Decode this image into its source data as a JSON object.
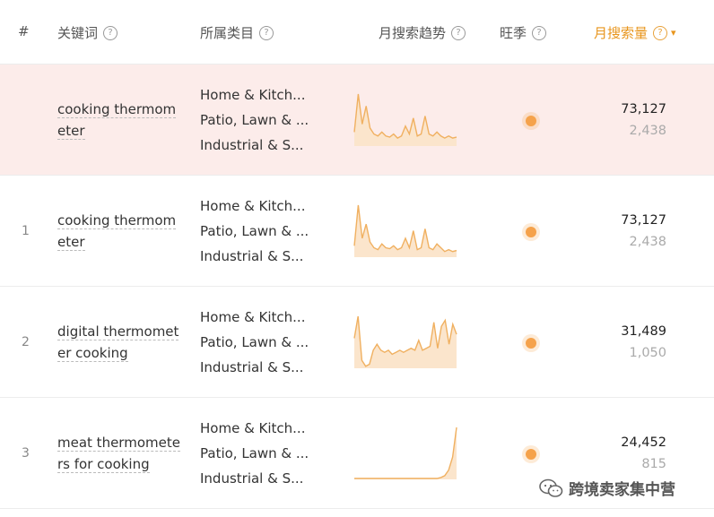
{
  "header": {
    "rank": "#",
    "keyword": "关键词",
    "category": "所属类目",
    "trend": "月搜索趋势",
    "season": "旺季",
    "volume": "月搜索量",
    "help_icon": "question-circle-icon",
    "sort_icon": "chevron-down-icon"
  },
  "colors": {
    "accent": "#e8951c",
    "highlight_row": "#fcecea",
    "trend_line": "#f0b060",
    "trend_fill": "#fbe5cc",
    "season_dot": "#f5a24b"
  },
  "rows": [
    {
      "rank": "",
      "keyword": "cooking thermometer",
      "categories": [
        "Home & Kitch...",
        "Patio, Lawn & ...",
        "Industrial & S..."
      ],
      "trend": [
        14,
        52,
        22,
        40,
        18,
        12,
        10,
        14,
        10,
        9,
        12,
        8,
        10,
        20,
        12,
        28,
        10,
        12,
        30,
        12,
        10,
        14,
        10,
        8,
        10,
        8,
        9
      ],
      "volume": "73,127",
      "volume_sub": "2,438"
    },
    {
      "rank": "1",
      "keyword": "cooking thermometer",
      "categories": [
        "Home & Kitch...",
        "Patio, Lawn & ...",
        "Industrial & S..."
      ],
      "trend": [
        12,
        55,
        20,
        35,
        16,
        10,
        8,
        14,
        10,
        9,
        12,
        8,
        10,
        20,
        10,
        28,
        8,
        10,
        30,
        10,
        8,
        14,
        10,
        6,
        8,
        6,
        7
      ],
      "volume": "73,127",
      "volume_sub": "2,438"
    },
    {
      "rank": "2",
      "keyword": "digital thermometer cooking",
      "categories": [
        "Home & Kitch...",
        "Patio, Lawn & ...",
        "Industrial & S..."
      ],
      "trend": [
        30,
        52,
        8,
        2,
        4,
        18,
        24,
        18,
        16,
        18,
        14,
        16,
        18,
        16,
        18,
        20,
        18,
        28,
        18,
        20,
        22,
        46,
        20,
        42,
        48,
        24,
        44,
        34
      ],
      "volume": "31,489",
      "volume_sub": "1,050"
    },
    {
      "rank": "3",
      "keyword": "meat thermometers for cooking",
      "categories": [
        "Home & Kitch...",
        "Patio, Lawn & ...",
        "Industrial & S..."
      ],
      "trend": [
        1,
        1,
        1,
        1,
        1,
        1,
        1,
        1,
        1,
        1,
        1,
        1,
        1,
        1,
        1,
        1,
        1,
        1,
        1,
        1,
        1,
        1,
        2,
        4,
        10,
        24,
        56
      ],
      "volume": "24,452",
      "volume_sub": "815"
    }
  ],
  "watermark": {
    "text": "跨境卖家集中营",
    "icon": "wechat-icon"
  }
}
